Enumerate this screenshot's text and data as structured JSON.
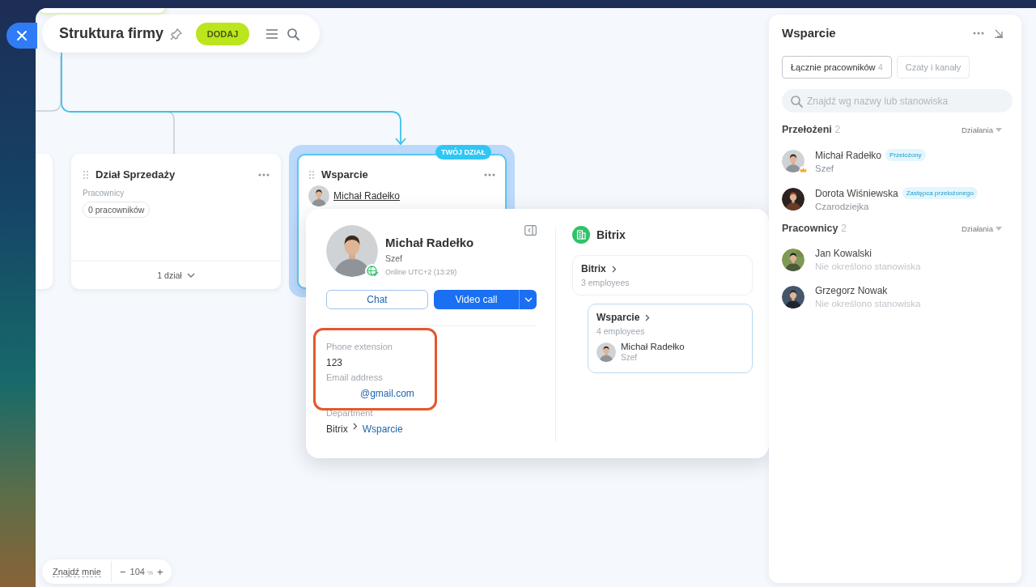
{
  "header": {
    "title": "Struktura firmy",
    "add_button": "DODAJ"
  },
  "departments": [
    {
      "title": "Dział Sprzedaży",
      "selected": false,
      "employees_label": "Pracownicy",
      "employee_count": "0 pracowników",
      "subdepartments": "1 dział"
    },
    {
      "title": "Wsparcie",
      "selected": true,
      "badge": "TWÓJ DZIAŁ",
      "head": {
        "name": "Michał Radełko"
      }
    }
  ],
  "popup": {
    "name": "Michał Radełko",
    "role": "Szef",
    "online": true,
    "status": "Online UTC+2 (13:29)",
    "chat_button": "Chat",
    "video_button": "Video call",
    "contact": {
      "highlighted": true,
      "fields": [
        {
          "label": "Phone extension",
          "value": "123",
          "kind": "text"
        },
        {
          "label": "Email address",
          "value": "@gmail.com",
          "kind": "link"
        }
      ]
    },
    "department": {
      "label": "Department",
      "path": [
        {
          "name": "Bitrix",
          "kind": "text"
        },
        {
          "name": "Wsparcie",
          "kind": "link"
        }
      ]
    },
    "company": "Bitrix",
    "tree": [
      {
        "name": "Bitrix",
        "count": "3 employees",
        "selected": false,
        "children": [
          {
            "name": "Wsparcie",
            "count": "4 employees",
            "selected": true,
            "head": {
              "name": "Michał Radełko",
              "role": "Szef"
            }
          }
        ]
      }
    ]
  },
  "zoom": {
    "find_me": "Znajdź mnie",
    "minus": "−",
    "value": "104",
    "unit": "%",
    "plus": "+"
  },
  "side_panel": {
    "title": "Wsparcie",
    "tabs": [
      {
        "label": "Łącznie pracowników",
        "count": "4",
        "selected": true
      },
      {
        "label": "Czaty i kanały",
        "selected": false
      }
    ],
    "search": {
      "placeholder": "Znajdź wg nazwy lub stanowiska"
    },
    "sections": [
      {
        "title": "Przełożeni",
        "count": "2",
        "action": "Działania",
        "people": [
          {
            "name": "Michał Radełko",
            "role": "Szef",
            "badge": "Przełożony",
            "head": true,
            "muted_role": false
          },
          {
            "name": "Dorota Wiśniewska",
            "role": "Czarodziejka",
            "badge": "Zastępca przełożonego",
            "head": false,
            "muted_role": false
          }
        ]
      },
      {
        "title": "Pracownicy",
        "count": "2",
        "action": "Działania",
        "people": [
          {
            "name": "Jan Kowalski",
            "role": "Nie określono stanowiska",
            "head": false,
            "muted_role": true
          },
          {
            "name": "Grzegorz Nowak",
            "role": "Nie określono stanowiska",
            "head": false,
            "muted_role": true
          }
        ]
      }
    ]
  }
}
